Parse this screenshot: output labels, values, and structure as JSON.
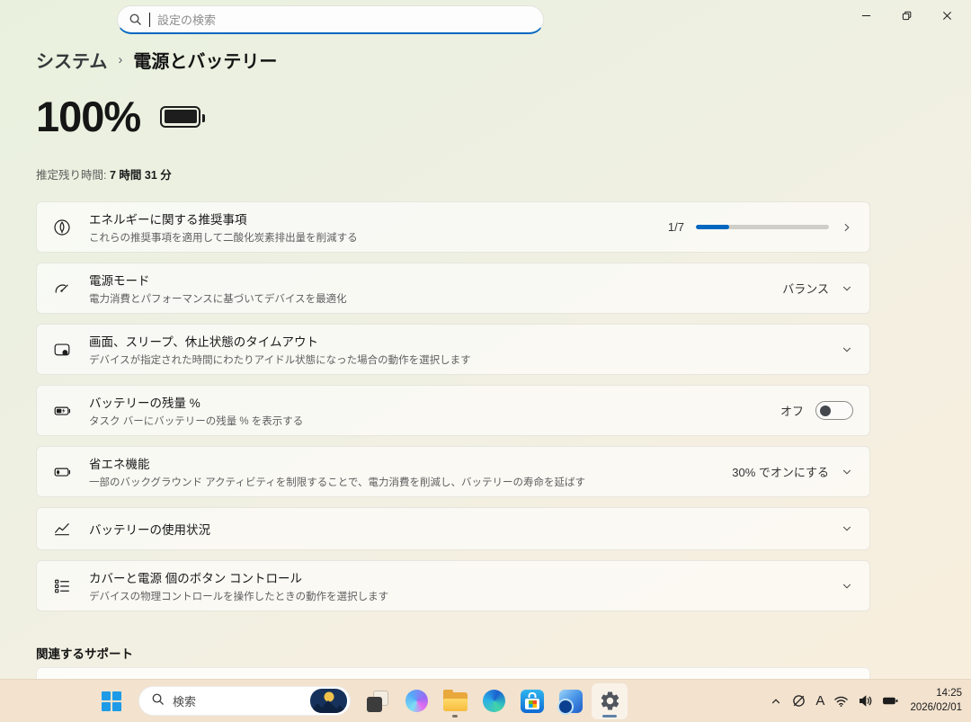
{
  "accent_color": "#0067c0",
  "titlebar": {
    "search_placeholder": "設定の検索"
  },
  "breadcrumb": {
    "root": "システム",
    "separator": "›",
    "current": "電源とバッテリー"
  },
  "status": {
    "percent": "100%",
    "estimate_label": "推定残り時間:",
    "estimate_value": "7 時間 31 分"
  },
  "cards": [
    {
      "icon": "leaf-circle-icon",
      "title": "エネルギーに関する推奨事項",
      "subtitle": "これらの推奨事項を適用して二酸化炭素排出量を削減する",
      "progress_label": "1/7",
      "progress_percent": 25
    },
    {
      "icon": "gauge-icon",
      "title": "電源モード",
      "subtitle": "電力消費とパフォーマンスに基づいてデバイスを最適化",
      "value": "バランス"
    },
    {
      "icon": "screen-sleep-icon",
      "title": "画面、スリープ、休止状態のタイムアウト",
      "subtitle": "デバイスが指定された時間にわたりアイドル状態になった場合の動作を選択します"
    },
    {
      "icon": "battery-bolt-icon",
      "title": "バッテリーの残量 %",
      "subtitle": "タスク バーにバッテリーの残量 % を表示する",
      "toggle_label": "オフ",
      "toggle_state": "off"
    },
    {
      "icon": "battery-leaf-icon",
      "title": "省エネ機能",
      "subtitle": "一部のバックグラウンド アクティビティを制限することで、電力消費を削減し、バッテリーの寿命を延ばす",
      "value": "30% でオンにする"
    },
    {
      "icon": "line-chart-icon",
      "title": "バッテリーの使用状況"
    },
    {
      "icon": "checklist-icon",
      "title": "カバーと電源 個のボタン コントロール",
      "subtitle": "デバイスの物理コントロールを操作したときの動作を選択します"
    }
  ],
  "related": {
    "heading": "関連するサポート"
  },
  "taskbar": {
    "search_label": "検索",
    "ime_indicator": "A",
    "time": "14:25",
    "date": "2026/02/01",
    "apps": [
      "windows-start",
      "search",
      "task-view",
      "copilot",
      "file-explorer",
      "edge",
      "microsoft-store",
      "outlook",
      "settings"
    ],
    "tray": [
      "chevron-up",
      "onedrive-off",
      "ime",
      "wifi",
      "volume",
      "battery"
    ]
  }
}
